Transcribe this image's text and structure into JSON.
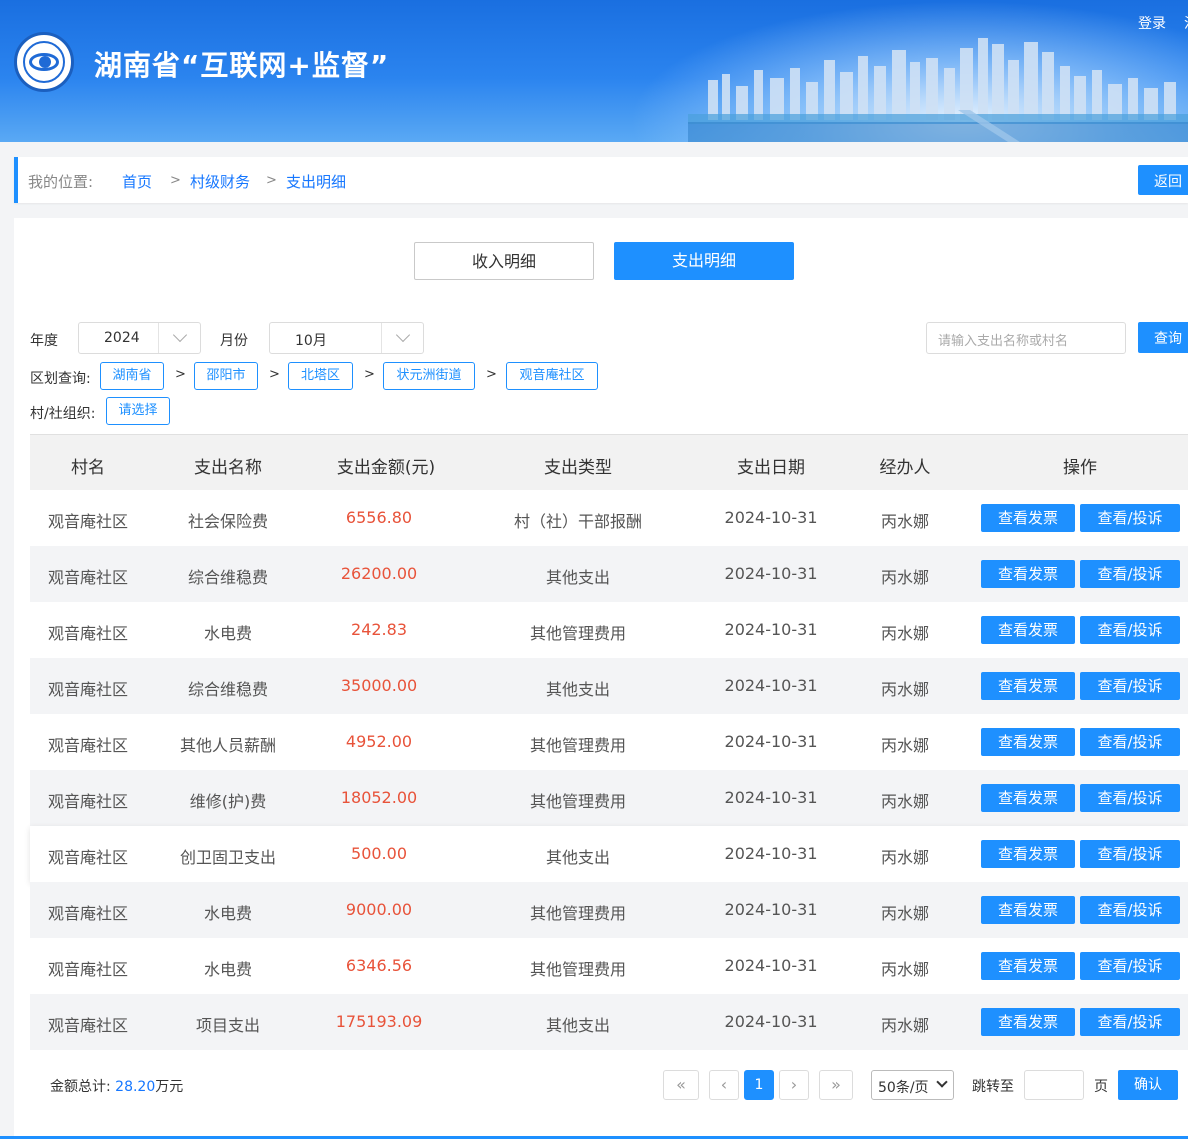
{
  "header": {
    "title": "湖南省“互联网+监督”",
    "login": "登录",
    "login_more": "注"
  },
  "breadcrumb": {
    "label": "我的位置:",
    "items": [
      "首页",
      "村级财务",
      "支出明细"
    ],
    "separator": ">",
    "back": "返回"
  },
  "tabs": {
    "income": "收入明细",
    "expense": "支出明细"
  },
  "filters": {
    "year_label": "年度",
    "year_value": "2024",
    "month_label": "月份",
    "month_value": "10月",
    "search_placeholder": "请输入支出名称或村名",
    "search_button": "查询",
    "region_label": "区划查询:",
    "regions": [
      "湖南省",
      "邵阳市",
      "北塔区",
      "状元洲街道",
      "观音庵社区"
    ],
    "region_separator": ">",
    "org_label": "村/社组织:",
    "org_button": "请选择"
  },
  "table": {
    "columns": [
      "村名",
      "支出名称",
      "支出金额(元)",
      "支出类型",
      "支出日期",
      "经办人",
      "操作"
    ],
    "actions": {
      "invoice": "查看发票",
      "view": "查看/投诉"
    },
    "rows": [
      {
        "village": "观音庵社区",
        "name": "社会保险费",
        "amount": "6556.80",
        "type": "村（社）干部报酬",
        "date": "2024-10-31",
        "handler": "丙水娜"
      },
      {
        "village": "观音庵社区",
        "name": "综合维稳费",
        "amount": "26200.00",
        "type": "其他支出",
        "date": "2024-10-31",
        "handler": "丙水娜"
      },
      {
        "village": "观音庵社区",
        "name": "水电费",
        "amount": "242.83",
        "type": "其他管理费用",
        "date": "2024-10-31",
        "handler": "丙水娜"
      },
      {
        "village": "观音庵社区",
        "name": "综合维稳费",
        "amount": "35000.00",
        "type": "其他支出",
        "date": "2024-10-31",
        "handler": "丙水娜"
      },
      {
        "village": "观音庵社区",
        "name": "其他人员薪酬",
        "amount": "4952.00",
        "type": "其他管理费用",
        "date": "2024-10-31",
        "handler": "丙水娜"
      },
      {
        "village": "观音庵社区",
        "name": "维修(护)费",
        "amount": "18052.00",
        "type": "其他管理费用",
        "date": "2024-10-31",
        "handler": "丙水娜"
      },
      {
        "village": "观音庵社区",
        "name": "创卫固卫支出",
        "amount": "500.00",
        "type": "其他支出",
        "date": "2024-10-31",
        "handler": "丙水娜"
      },
      {
        "village": "观音庵社区",
        "name": "水电费",
        "amount": "9000.00",
        "type": "其他管理费用",
        "date": "2024-10-31",
        "handler": "丙水娜"
      },
      {
        "village": "观音庵社区",
        "name": "水电费",
        "amount": "6346.56",
        "type": "其他管理费用",
        "date": "2024-10-31",
        "handler": "丙水娜"
      },
      {
        "village": "观音庵社区",
        "name": "项目支出",
        "amount": "175193.09",
        "type": "其他支出",
        "date": "2024-10-31",
        "handler": "丙水娜"
      }
    ]
  },
  "footer": {
    "total_label": "金额总计:",
    "total_value": "28.20",
    "total_unit": "万元",
    "first": "«",
    "prev": "‹",
    "page": "1",
    "next": "›",
    "last": "»",
    "page_size": "50条/页",
    "jump_label": "跳转至",
    "page_unit": "页",
    "confirm": "确认"
  },
  "colors": {
    "accent": "#1e90ff",
    "amount": "#e8533a"
  }
}
